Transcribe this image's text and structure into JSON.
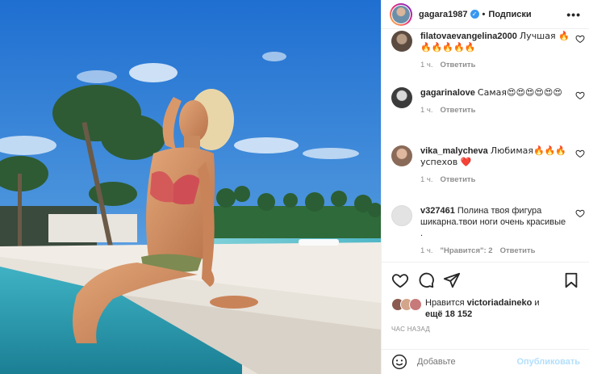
{
  "header": {
    "username": "gagara1987",
    "separator": "•",
    "follow_label": "Подписки",
    "more_label": "•••"
  },
  "comments": [
    {
      "user": "filatovaevangelina2000",
      "text": "Лучшая 🔥🔥🔥🔥🔥🔥",
      "time": "1 ч.",
      "reply": "Ответить",
      "likes": ""
    },
    {
      "user": "gagarinalove",
      "text": "Самая😍😍😍😍😍😍",
      "time": "1 ч.",
      "reply": "Ответить",
      "likes": ""
    },
    {
      "user": "vika_malycheva",
      "text": "Любимая🔥🔥🔥 успехов ❤️",
      "time": "1 ч.",
      "reply": "Ответить",
      "likes": ""
    },
    {
      "user": "v327461",
      "text": "Полина твоя фигура шикарна.твои ноги очень красивые .",
      "time": "1 ч.",
      "reply": "Ответить",
      "likes": "\"Нравится\": 2"
    }
  ],
  "likes": {
    "prefix": "Нравится",
    "user": "victoriadaineko",
    "and": "и",
    "more": "ещё 18 152"
  },
  "timestamp": "ЧАС НАЗАД",
  "add_comment": {
    "placeholder": "Добавьте",
    "publish_label": "Опубликовать"
  },
  "colors": {
    "verified": "#3897f0",
    "publish_disabled": "#b2dffc",
    "secondary_text": "#8e8e8e",
    "reply_heart": "#ed4956"
  }
}
